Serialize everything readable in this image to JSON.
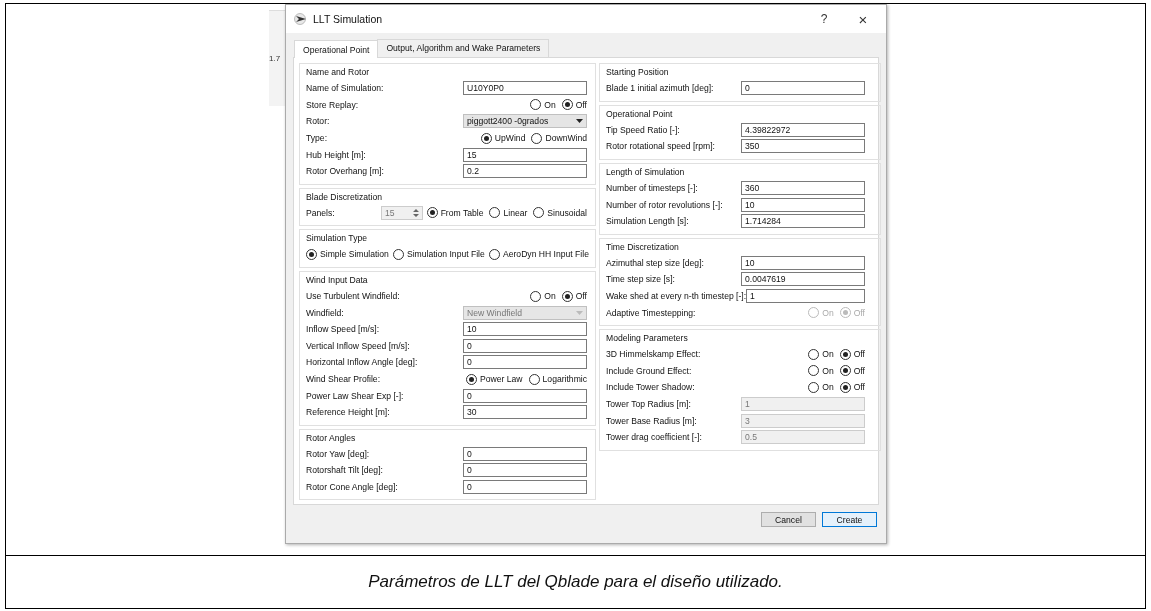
{
  "background_app": {
    "fragment": "1.7"
  },
  "dialog": {
    "title": "LLT Simulation",
    "help": "?",
    "close": "×",
    "tabs": [
      {
        "label": "Operational Point",
        "selected": true
      },
      {
        "label": "Output, Algorithm and Wake Parameters",
        "selected": false
      }
    ],
    "left_groups": [
      {
        "title": "Name and Rotor",
        "rows": [
          {
            "kind": "input",
            "label": "Name of Simulation:",
            "value": "U10Y0P0",
            "disabled": false
          },
          {
            "kind": "radio",
            "label": "Store Replay:",
            "disabled": false,
            "options": [
              {
                "label": "On",
                "selected": false
              },
              {
                "label": "Off",
                "selected": true
              }
            ]
          },
          {
            "kind": "dropdown",
            "label": "Rotor:",
            "value": "piggott2400 -0grados",
            "disabled": false
          },
          {
            "kind": "radio",
            "label": "Type:",
            "disabled": false,
            "options": [
              {
                "label": "UpWind",
                "selected": true
              },
              {
                "label": "DownWind",
                "selected": false
              }
            ]
          },
          {
            "kind": "input",
            "label": "Hub Height [m]:",
            "value": "15",
            "disabled": false
          },
          {
            "kind": "input",
            "label": "Rotor Overhang [m]:",
            "value": "0.2",
            "disabled": false
          }
        ]
      },
      {
        "title": "Blade Discretization",
        "rows": [
          {
            "kind": "spin",
            "label": "Panels:",
            "value": "15",
            "disabled": true,
            "options": [
              {
                "label": "From Table",
                "selected": true
              },
              {
                "label": "Linear",
                "selected": false
              },
              {
                "label": "Sinusoidal",
                "selected": false
              }
            ]
          }
        ]
      },
      {
        "title": "Simulation Type",
        "rows": [
          {
            "kind": "choices",
            "options": [
              {
                "label": "Simple Simulation",
                "selected": true
              },
              {
                "label": "Simulation Input File",
                "selected": false
              },
              {
                "label": "AeroDyn HH Input File",
                "selected": false
              }
            ]
          }
        ]
      },
      {
        "title": "Wind Input Data",
        "rows": [
          {
            "kind": "radio",
            "label": "Use Turbulent Windfield:",
            "disabled": false,
            "options": [
              {
                "label": "On",
                "selected": false
              },
              {
                "label": "Off",
                "selected": true
              }
            ]
          },
          {
            "kind": "dropdown",
            "label": "Windfield:",
            "value": "New Windfield",
            "disabled": true
          },
          {
            "kind": "input",
            "label": "Inflow Speed [m/s]:",
            "value": "10",
            "disabled": false
          },
          {
            "kind": "input",
            "label": "Vertical Inflow Speed [m/s]:",
            "value": "0",
            "disabled": false
          },
          {
            "kind": "input",
            "label": "Horizontal Inflow Angle [deg]:",
            "value": "0",
            "disabled": false
          },
          {
            "kind": "radio",
            "label": "Wind Shear Profile:",
            "disabled": false,
            "options": [
              {
                "label": "Power Law",
                "selected": true
              },
              {
                "label": "Logarithmic",
                "selected": false
              }
            ]
          },
          {
            "kind": "input",
            "label": "Power Law Shear Exp [-]:",
            "value": "0",
            "disabled": false
          },
          {
            "kind": "input",
            "label": "Reference Height [m]:",
            "value": "30",
            "disabled": false
          }
        ]
      },
      {
        "title": "Rotor Angles",
        "rows": [
          {
            "kind": "input",
            "label": "Rotor Yaw [deg]:",
            "value": "0",
            "disabled": false
          },
          {
            "kind": "input",
            "label": "Rotorshaft Tilt [deg]:",
            "value": "0",
            "disabled": false
          },
          {
            "kind": "input",
            "label": "Rotor Cone Angle [deg]:",
            "value": "0",
            "disabled": false
          }
        ]
      }
    ],
    "right_groups": [
      {
        "title": "Starting Position",
        "rows": [
          {
            "kind": "input",
            "label": "Blade 1 initial azimuth [deg]:",
            "value": "0",
            "disabled": false
          }
        ]
      },
      {
        "title": "Operational Point",
        "rows": [
          {
            "kind": "input",
            "label": "Tip Speed Ratio [-]:",
            "value": "4.39822972",
            "disabled": false
          },
          {
            "kind": "input",
            "label": "Rotor rotational speed [rpm]:",
            "value": "350",
            "disabled": false
          }
        ]
      },
      {
        "title": "Length of Simulation",
        "rows": [
          {
            "kind": "input",
            "label": "Number of timesteps [-]:",
            "value": "360",
            "disabled": false
          },
          {
            "kind": "input",
            "label": "Number of rotor revolutions [-]:",
            "value": "10",
            "disabled": false
          },
          {
            "kind": "input",
            "label": "Simulation Length [s]:",
            "value": "1.714284",
            "disabled": false
          }
        ]
      },
      {
        "title": "Time Discretization",
        "rows": [
          {
            "kind": "input",
            "label": "Azimuthal step size [deg]:",
            "value": "10",
            "disabled": false
          },
          {
            "kind": "input",
            "label": "Time step size [s]:",
            "value": "0.0047619",
            "disabled": false
          },
          {
            "kind": "input",
            "label": "Wake shed at every n-th timestep [-]:",
            "value": "1",
            "disabled": false
          },
          {
            "kind": "radio",
            "label": "Adaptive Timestepping:",
            "disabled": true,
            "options": [
              {
                "label": "On",
                "selected": false
              },
              {
                "label": "Off",
                "selected": true
              }
            ]
          }
        ]
      },
      {
        "title": "Modeling Parameters",
        "rows": [
          {
            "kind": "radio",
            "label": "3D Himmelskamp Effect:",
            "disabled": false,
            "options": [
              {
                "label": "On",
                "selected": false
              },
              {
                "label": "Off",
                "selected": true
              }
            ]
          },
          {
            "kind": "radio",
            "label": "Include Ground Effect:",
            "disabled": false,
            "options": [
              {
                "label": "On",
                "selected": false
              },
              {
                "label": "Off",
                "selected": true
              }
            ]
          },
          {
            "kind": "radio",
            "label": "Include Tower Shadow:",
            "disabled": false,
            "options": [
              {
                "label": "On",
                "selected": false
              },
              {
                "label": "Off",
                "selected": true
              }
            ]
          },
          {
            "kind": "input",
            "label": "Tower Top Radius [m]:",
            "value": "1",
            "disabled": true
          },
          {
            "kind": "input",
            "label": "Tower Base Radius [m]:",
            "value": "3",
            "disabled": true
          },
          {
            "kind": "input",
            "label": "Tower drag coefficient [-]:",
            "value": "0.5",
            "disabled": true
          }
        ]
      }
    ],
    "buttons": [
      {
        "label": "Cancel",
        "default": false
      },
      {
        "label": "Create",
        "default": true
      }
    ]
  },
  "caption": "Parámetros de LLT del Qblade para el diseño utilizado."
}
